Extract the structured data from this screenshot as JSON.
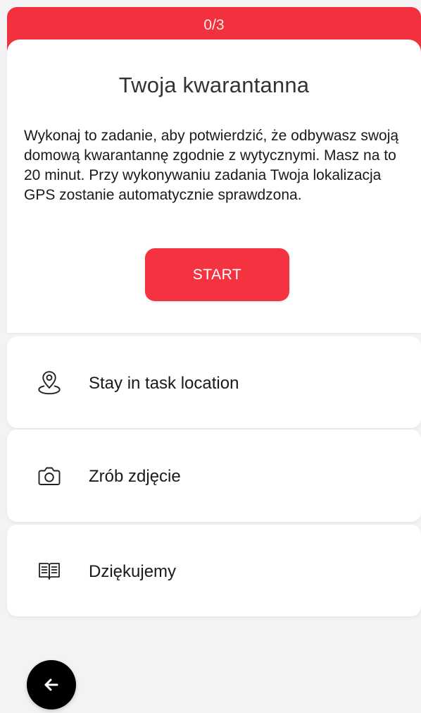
{
  "progress": {
    "label": "0/3"
  },
  "header": {
    "title": "Twoja kwarantanna"
  },
  "description": "Wykonaj to zadanie, aby potwierdzić, że odbywasz swoją domową kwarantannę zgodnie z wytycznymi. Masz na to 20 minut. Przy wykonywaniu zadania Twoja lokalizacja GPS zostanie automatycznie sprawdzona.",
  "actions": {
    "start_label": "START"
  },
  "tasks": [
    {
      "label": "Stay in task location",
      "icon": "location-pin-icon"
    },
    {
      "label": "Zrób zdjęcie",
      "icon": "camera-icon"
    },
    {
      "label": "Dziękujemy",
      "icon": "book-icon"
    }
  ],
  "navigation": {
    "back_icon": "arrow-left-icon"
  },
  "colors": {
    "accent": "#f53340",
    "progress": "#f1313d",
    "background": "#f3f3f3",
    "card": "#ffffff",
    "text": "#1a1a1a",
    "title": "#333333",
    "back_button": "#000000"
  }
}
